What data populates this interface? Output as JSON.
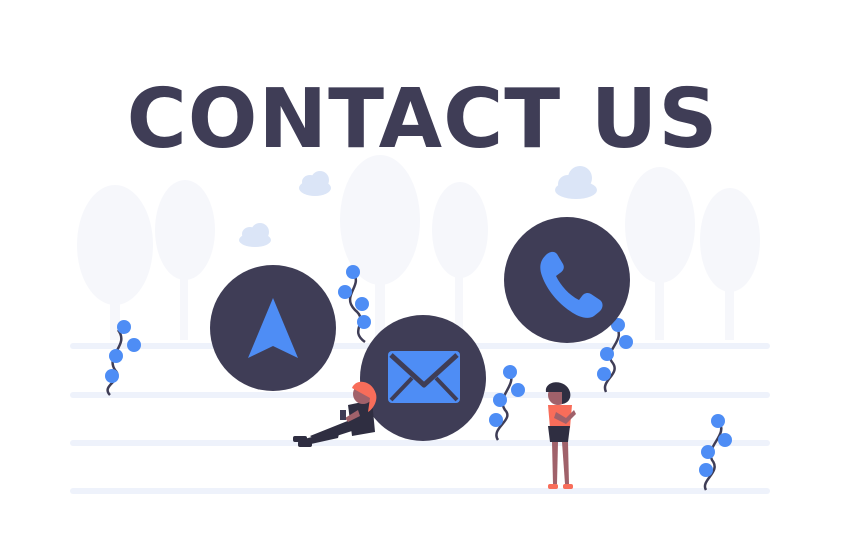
{
  "heading": "CONTACT US",
  "colors": {
    "primary": "#3f3d56",
    "accent": "#4e8df5",
    "ground": "#eef2fb",
    "skin": "#a0616a",
    "shirt": "#f86d5a"
  },
  "icons": {
    "location": "navigation-arrow-icon",
    "email": "envelope-icon",
    "phone": "phone-icon"
  }
}
